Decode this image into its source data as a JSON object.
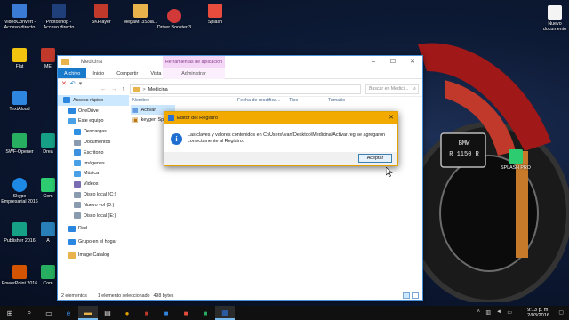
{
  "desktop": {
    "icons": [
      {
        "label": "iVideoConvert - Acceso directo",
        "color": "#3a7bd5"
      },
      {
        "label": "Photoshop - Acceso directo",
        "color": "#1f3f7a"
      },
      {
        "label": "5KPlayer",
        "color": "#c0392b"
      },
      {
        "label": "MegaMI 3Spla...",
        "color": "#e8b34a"
      },
      {
        "label": "Driver Booster 3",
        "color": "#d23a3a"
      },
      {
        "label": "Splash",
        "color": "#e84c3d"
      },
      {
        "label": "Nuevo documento",
        "color": "#f4f4f4"
      },
      {
        "label": "Flat",
        "color": "#f1c40f"
      },
      {
        "label": "ME",
        "color": "#c0392b"
      },
      {
        "label": "TextAloud",
        "color": "#2e86de"
      },
      {
        "label": "SWF-Opener",
        "color": "#27ae60"
      },
      {
        "label": "Drea",
        "color": "#16a085"
      },
      {
        "label": "Skype Empresarial 2016",
        "color": "#1e88e5"
      },
      {
        "label": "Com",
        "color": "#2ecc71"
      },
      {
        "label": "Publisher 2016",
        "color": "#16a085"
      },
      {
        "label": "A",
        "color": "#2980b9"
      },
      {
        "label": "PowerPoint 2016",
        "color": "#d35400"
      },
      {
        "label": "Com",
        "color": "#27ae60"
      },
      {
        "label": "SPLASH PRO",
        "color": "#2ecc71"
      }
    ],
    "plate": {
      "line1": "BMW",
      "line2": "R 1150 R"
    }
  },
  "explorer": {
    "title": "Medicina",
    "context_tab_header": "Herramientas de aplicación",
    "tabs": [
      "Archivo",
      "Inicio",
      "Compartir",
      "Vista"
    ],
    "context_tab": "Administrar",
    "breadcrumb_sep": ">",
    "address": "Medicina",
    "search_placeholder": "Buscar en Medici...",
    "nav_items": [
      {
        "label": "Acceso rápido",
        "color": "#2b86e0"
      },
      {
        "label": "OneDrive",
        "color": "#2b86e0"
      },
      {
        "label": "Este equipo",
        "color": "#4aa0e6"
      },
      {
        "label": "Descargas",
        "color": "#2f8fe0"
      },
      {
        "label": "Documentos",
        "color": "#8a9bb0"
      },
      {
        "label": "Escritorio",
        "color": "#3d8fe0"
      },
      {
        "label": "Imágenes",
        "color": "#4aa0e6"
      },
      {
        "label": "Música",
        "color": "#4aa0e6"
      },
      {
        "label": "Videos",
        "color": "#7a6cb3"
      },
      {
        "label": "Disco local (C:)",
        "color": "#8a9bb0"
      },
      {
        "label": "Nuevo vol (D:)",
        "color": "#8a9bb0"
      },
      {
        "label": "Disco local (E:)",
        "color": "#8a9bb0"
      },
      {
        "label": "Red",
        "color": "#2b86e0"
      },
      {
        "label": "Grupo en el hogar",
        "color": "#2b86e0"
      },
      {
        "label": "Image Catalog",
        "color": "#e8b34a"
      }
    ],
    "columns": [
      "Nombre",
      "Fecha de modifica...",
      "Tipo",
      "Tamaño"
    ],
    "files": [
      {
        "name": "Activar",
        "selected": true
      },
      {
        "name": "keygen Spl",
        "selected": false
      }
    ],
    "status": {
      "count": "2 elementos",
      "selection": "1 elemento seleccionado",
      "size": "498 bytes"
    }
  },
  "dialog": {
    "title": "Editor del Registro",
    "message": "Las claves y valores contenidos en C:\\Users\\ivan\\Desktop\\Medicina\\Activar.reg se agregaron correctamente al Registro.",
    "button": "Aceptar"
  },
  "taskbar": {
    "time": "9:13 p. m.",
    "date": "2/03/2016"
  }
}
